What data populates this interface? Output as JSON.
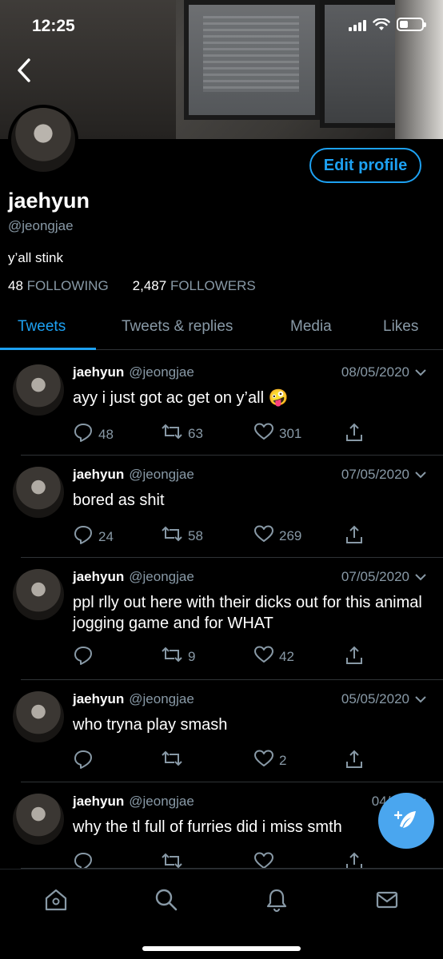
{
  "status_bar": {
    "time": "12:25"
  },
  "profile": {
    "name": "jaehyun",
    "handle": "@jeongjae",
    "bio": "y’all stink",
    "following_count": "48",
    "following_label": "FOLLOWING",
    "followers_count": "2,487",
    "followers_label": "FOLLOWERS",
    "edit_label": "Edit profile"
  },
  "tabs": [
    {
      "label": "Tweets",
      "active": true
    },
    {
      "label": "Tweets & replies"
    },
    {
      "label": "Media"
    },
    {
      "label": "Likes"
    }
  ],
  "tweets": [
    {
      "name": "jaehyun",
      "handle": "@jeongjae",
      "date": "08/05/2020",
      "text": "ayy i just got ac get on y’all 🤪",
      "replies": "48",
      "retweets": "63",
      "likes": "301"
    },
    {
      "name": "jaehyun",
      "handle": "@jeongjae",
      "date": "07/05/2020",
      "text": "bored as shit",
      "replies": "24",
      "retweets": "58",
      "likes": "269"
    },
    {
      "name": "jaehyun",
      "handle": "@jeongjae",
      "date": "07/05/2020",
      "text": "ppl rlly out here with their dicks out for this animal jogging game and for WHAT",
      "replies": "",
      "retweets": "9",
      "likes": "42"
    },
    {
      "name": "jaehyun",
      "handle": "@jeongjae",
      "date": "05/05/2020",
      "text": "who tryna play smash",
      "replies": "",
      "retweets": "",
      "likes": "2"
    },
    {
      "name": "jaehyun",
      "handle": "@jeongjae",
      "date": "04/05/",
      "text": "why the tl full of furries did i miss smth",
      "replies": "",
      "retweets": "",
      "likes": ""
    }
  ],
  "colors": {
    "accent": "#1da1f2",
    "muted": "#8899a6",
    "background": "#000000",
    "fab": "#4aa6ef"
  },
  "icons": {
    "back": "chevron-left-icon",
    "reply": "reply-icon",
    "retweet": "retweet-icon",
    "like": "heart-icon",
    "share": "share-icon",
    "compose": "compose-icon",
    "nav": [
      "home-icon",
      "search-icon",
      "bell-icon",
      "mail-icon"
    ]
  }
}
